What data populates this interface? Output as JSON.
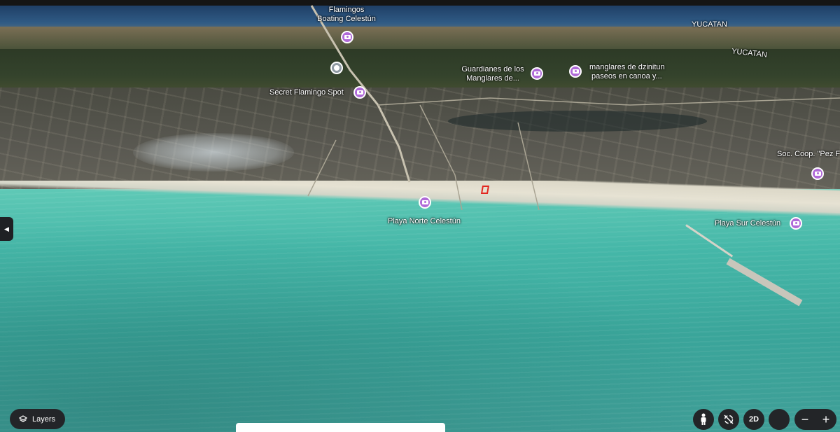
{
  "map": {
    "places": [
      {
        "name_line1": "Flamingos",
        "name_line2": "Boating Celestún"
      },
      {
        "name": "Secret Flamingo Spot"
      },
      {
        "name_line1": "Guardianes de los",
        "name_line2": "Manglares de..."
      },
      {
        "name_line1": "manglares de dzinitun",
        "name_line2": "paseos en canoa y..."
      },
      {
        "name": "Soc. Coop. \"Pez F"
      },
      {
        "name": "Playa Norte Celestún"
      },
      {
        "name": "Playa Sur Celestún"
      }
    ],
    "regions": [
      "YUCATAN",
      "YUCATAN"
    ],
    "pin_icon": "camera-icon",
    "pin_color": "#b06ad8",
    "marker_color": "#e2261f"
  },
  "controls": {
    "side_toggle_icon": "◀",
    "layers_label": "Layers",
    "view_2d_label": "2D",
    "zoom_out_label": "−",
    "zoom_in_label": "+"
  }
}
